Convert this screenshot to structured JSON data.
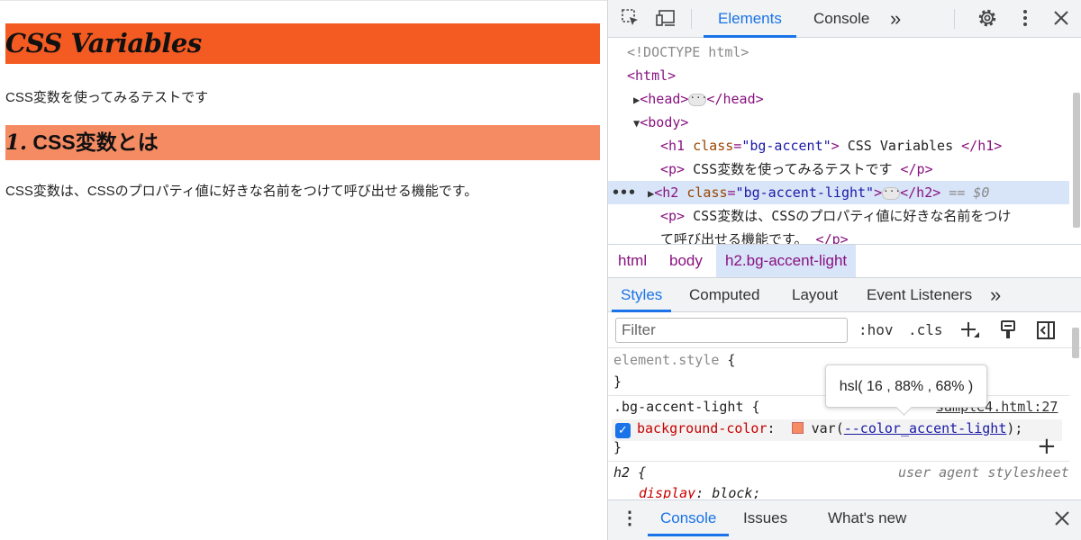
{
  "page": {
    "h1": "CSS Variables",
    "p1": "CSS変数を使ってみるテストです",
    "h2_num": "1.",
    "h2_text": " CSS変数とは",
    "p2": "CSS変数は、CSSのプロパティ値に好きな名前をつけて呼び出せる機能です。"
  },
  "devtools": {
    "tabs": [
      "Elements",
      "Console"
    ],
    "more_tabs": "»",
    "icons": {
      "inspect": "inspect-element-icon",
      "device": "device-toolbar-icon",
      "settings": "gear-icon",
      "menu": "kebab-menu-icon",
      "close": "close-icon"
    },
    "dom": {
      "doctype": "<!DOCTYPE html>",
      "html_open": "<html>",
      "head_open": "<head>",
      "head_close": "</head>",
      "body_open": "<body>",
      "h1_tag": "<h1",
      "h1_attr": "class",
      "h1_val": "\"bg-accent\"",
      "h1_text": " CSS Variables ",
      "h1_close": "</h1>",
      "p1_open": "<p>",
      "p1_text": " CSS変数を使ってみるテストです ",
      "p1_close": "</p>",
      "h2_tag": "<h2",
      "h2_attr": "class",
      "h2_val": "\"bg-accent-light\"",
      "h2_close": "</h2>",
      "selected_marker": "== $0",
      "p2_open": "<p>",
      "p2_text_1": " CSS変数は、CSSのプロパティ値に好きな名前をつけ",
      "p2_text_2": "て呼び出せる機能です。 ",
      "p2_close": "</p>"
    },
    "breadcrumbs": [
      "html",
      "body",
      "h2.bg-accent-light"
    ],
    "subtabs": [
      "Styles",
      "Computed",
      "Layout",
      "Event Listeners"
    ],
    "filter_placeholder": "Filter",
    "hov": ":hov",
    "cls": ".cls",
    "styles": {
      "element_style": "element.style",
      "rule_selector": ".bg-accent-light",
      "rule_source": "sample4.html:27",
      "prop_name": "background-color",
      "prop_fn": "var(",
      "prop_var": "--color_accent-light",
      "prop_end": ");",
      "ua_selector": "h2",
      "ua_label": "user agent stylesheet",
      "ua_prop": "display",
      "ua_value": "block"
    },
    "tooltip": "hsl( 16 , 88% , 68% )",
    "drawer_tabs": [
      "Console",
      "Issues",
      "What's new"
    ]
  },
  "colors": {
    "accent": "#f45b22",
    "accent_light": "#f58b63",
    "devtools_blue": "#1a73e8"
  }
}
